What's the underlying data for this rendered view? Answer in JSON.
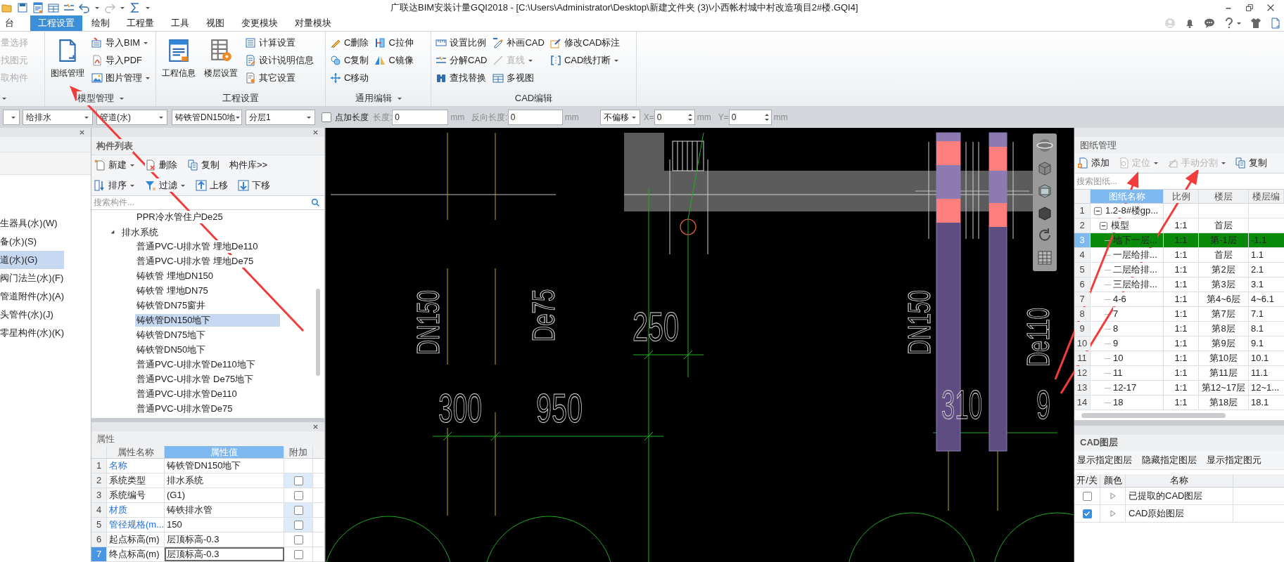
{
  "title_bar": {
    "title": "广联达BIM安装计量GQI2018 - [C:\\Users\\Administrator\\Desktop\\新建文件夹 (3)\\小西帐村城中村改造项目2#楼.GQI4]"
  },
  "menu_tabs": [
    {
      "label": "台",
      "selected": false
    },
    {
      "label": "工程设置",
      "selected": true
    },
    {
      "label": "绘制",
      "selected": false
    },
    {
      "label": "工程量",
      "selected": false
    },
    {
      "label": "工具",
      "selected": false
    },
    {
      "label": "视图",
      "selected": false
    },
    {
      "label": "变更模块",
      "selected": false
    },
    {
      "label": "对量模块",
      "selected": false
    }
  ],
  "ribbon_groups": [
    {
      "menu": true,
      "items": [
        {
          "label": "量选择",
          "kind": "small",
          "disabled": true,
          "dropdown": false
        },
        {
          "label": "找图元",
          "kind": "small",
          "disabled": true,
          "dropdown": false
        },
        {
          "label": "取构件",
          "kind": "small",
          "disabled": true,
          "dropdown": false
        }
      ]
    },
    {
      "label": "模型管理",
      "menu": true,
      "items": [
        {
          "label": "图纸管理",
          "kind": "large",
          "disabled": false,
          "dropdown": false
        },
        {
          "label": "导入BIM",
          "kind": "small",
          "disabled": false,
          "dropdown": true
        },
        {
          "label": "导入PDF",
          "kind": "small",
          "disabled": false,
          "dropdown": false
        },
        {
          "label": "图片管理",
          "kind": "small",
          "disabled": false,
          "dropdown": true
        }
      ]
    },
    {
      "label": "工程设置",
      "menu": false,
      "items": [
        {
          "label": "工程信息",
          "kind": "large",
          "disabled": false,
          "dropdown": false
        },
        {
          "label": "楼层设置",
          "kind": "large",
          "disabled": false,
          "dropdown": false
        },
        {
          "label": "计算设置",
          "kind": "small",
          "disabled": false,
          "dropdown": false
        },
        {
          "label": "设计说明信息",
          "kind": "small",
          "disabled": false,
          "dropdown": false
        },
        {
          "label": "其它设置",
          "kind": "small",
          "disabled": false,
          "dropdown": false
        }
      ]
    },
    {
      "label": "通用编辑",
      "menu": true,
      "items": [
        {
          "label": "C删除",
          "kind": "small",
          "disabled": false,
          "dropdown": false
        },
        {
          "label": "C复制",
          "kind": "small",
          "disabled": false,
          "dropdown": false
        },
        {
          "label": "C移动",
          "kind": "small",
          "disabled": false,
          "dropdown": false
        },
        {
          "label": "C拉伸",
          "kind": "small",
          "disabled": false,
          "dropdown": false
        },
        {
          "label": "C镜像",
          "kind": "small",
          "disabled": false,
          "dropdown": false
        }
      ]
    },
    {
      "label": "CAD编辑",
      "menu": false,
      "items": [
        {
          "label": "设置比例",
          "kind": "small",
          "disabled": false,
          "dropdown": false
        },
        {
          "label": "分解CAD",
          "kind": "small",
          "disabled": false,
          "dropdown": false
        },
        {
          "label": "查找替换",
          "kind": "small",
          "disabled": false,
          "dropdown": false
        },
        {
          "label": "补画CAD",
          "kind": "small",
          "disabled": false,
          "dropdown": false
        },
        {
          "label": "直线",
          "kind": "small",
          "disabled": true,
          "dropdown": true
        },
        {
          "label": "多视图",
          "kind": "small",
          "disabled": false,
          "dropdown": false
        },
        {
          "label": "修改CAD标注",
          "kind": "small",
          "disabled": false,
          "dropdown": false
        },
        {
          "label": "CAD线打断",
          "kind": "small",
          "disabled": false,
          "dropdown": true
        }
      ]
    }
  ],
  "toolbar": [
    {
      "kind": "dropdown"
    },
    {
      "kind": "dropdown",
      "value": "给排水"
    },
    {
      "kind": "dropdown",
      "value": "管道(水)"
    },
    {
      "kind": "dropdown",
      "value": "铸铁管DN150地"
    },
    {
      "kind": "dropdown",
      "value": "分层1"
    },
    {
      "kind": "checkbox",
      "label": "点加长度",
      "checked": false
    },
    {
      "kind": "field",
      "label": "长度:",
      "value": "0",
      "unit": "mm",
      "disabled": true
    },
    {
      "kind": "field",
      "label": "反向长度:",
      "value": "0",
      "unit": "mm",
      "disabled": true
    },
    {
      "kind": "dropdown",
      "value": "不偏移"
    },
    {
      "kind": "spin",
      "label": "X=",
      "value": "0",
      "unit": "mm",
      "disabled": true
    },
    {
      "kind": "spin",
      "label": "Y=",
      "value": "0",
      "unit": "mm",
      "disabled": true
    }
  ],
  "category_panel": {
    "items": [
      {
        "label": "生器具(水)(W)",
        "selected": false
      },
      {
        "label": "备(水)(S)",
        "selected": false
      },
      {
        "label": "道(水)(G)",
        "selected": true
      },
      {
        "label": "阀门法兰(水)(F)",
        "selected": false
      },
      {
        "label": "管道附件(水)(A)",
        "selected": false
      },
      {
        "label": "头管件(水)(J)",
        "selected": false
      },
      {
        "label": "零星构件(水)(K)",
        "selected": false
      }
    ]
  },
  "component_panel": {
    "title": "构件列表",
    "toolbar": [
      {
        "label": "新建",
        "dropdown": true
      },
      {
        "label": "删除",
        "dropdown": false
      },
      {
        "label": "复制",
        "dropdown": false
      },
      {
        "label": "构件库>>",
        "dropdown": false
      },
      {
        "label": "排序",
        "dropdown": true
      },
      {
        "label": "过滤",
        "dropdown": true
      },
      {
        "label": "上移",
        "dropdown": false
      },
      {
        "label": "下移",
        "dropdown": false
      }
    ],
    "search_placeholder": "搜索构件...",
    "tree": [
      {
        "label": "PPR冷水管住户De25",
        "selected": false
      },
      {
        "label": "排水系统",
        "selected": false,
        "expanded": true,
        "children": [
          {
            "label": "普通PVC-U排水管 埋地De110",
            "selected": false
          },
          {
            "label": "普通PVC-U排水管 埋地De75",
            "selected": false
          },
          {
            "label": "铸铁管 埋地DN150",
            "selected": false
          },
          {
            "label": "铸铁管 埋地DN75",
            "selected": false
          },
          {
            "label": "铸铁管DN75窗井",
            "selected": false
          },
          {
            "label": "铸铁管DN150地下",
            "selected": true
          },
          {
            "label": "铸铁管DN75地下",
            "selected": false
          },
          {
            "label": "铸铁管DN50地下",
            "selected": false
          },
          {
            "label": "普通PVC-U排水管De110地下",
            "selected": false
          },
          {
            "label": "普通PVC-U排水管 De75地下",
            "selected": false
          },
          {
            "label": "普通PVC-U排水管De110",
            "selected": false
          },
          {
            "label": "普通PVC-U排水管De75",
            "selected": false
          }
        ]
      }
    ]
  },
  "properties_panel": {
    "title": "属性",
    "columns": [
      "属性名称",
      "属性值",
      "附加"
    ],
    "rows": [
      {
        "num": "1",
        "name": "名称",
        "value": "铸铁管DN150地下",
        "public": true,
        "selected": false
      },
      {
        "num": "2",
        "name": "系统类型",
        "value": "排水系统",
        "public": false,
        "selected": false,
        "checked": false,
        "highlighted": true
      },
      {
        "num": "3",
        "name": "系统编号",
        "value": "(G1)",
        "public": false,
        "selected": false,
        "checked": false,
        "highlighted": false
      },
      {
        "num": "4",
        "name": "材质",
        "value": "铸铁排水管",
        "public": true,
        "selected": false,
        "checked": false,
        "highlighted": true
      },
      {
        "num": "5",
        "name": "管径规格(m...",
        "value": "150",
        "public": true,
        "selected": false,
        "checked": false,
        "highlighted": true
      },
      {
        "num": "6",
        "name": "起点标高(m)",
        "value": "层顶标高-0.3",
        "public": false,
        "selected": false,
        "checked": false,
        "highlighted": false
      },
      {
        "num": "7",
        "name": "终点标高(m)",
        "value": "层顶标高-0.3",
        "public": false,
        "selected": true,
        "checked": false,
        "highlighted": false
      }
    ]
  },
  "canvas": {
    "labels": [
      {
        "text": "DN150",
        "kind": "vertical"
      },
      {
        "text": "De75",
        "kind": "vertical"
      },
      {
        "text": "250",
        "kind": "horizontal"
      },
      {
        "text": "300",
        "kind": "horizontal"
      },
      {
        "text": "950",
        "kind": "horizontal"
      },
      {
        "text": "DN150",
        "kind": "vertical"
      },
      {
        "text": "De110",
        "kind": "vertical"
      },
      {
        "text": "310",
        "kind": "horizontal"
      },
      {
        "text": "9",
        "kind": "horizontal"
      }
    ]
  },
  "drawing_panel": {
    "title": "图纸管理",
    "toolbar": [
      {
        "label": "添加",
        "disabled": false,
        "dropdown": false
      },
      {
        "label": "定位",
        "disabled": true,
        "dropdown": true
      },
      {
        "label": "手动分割",
        "disabled": true,
        "dropdown": true
      },
      {
        "label": "复制",
        "disabled": false,
        "dropdown": false
      }
    ],
    "search_placeholder": "搜索图纸...",
    "columns": [
      "图纸名称",
      "比例",
      "楼层",
      "楼层编"
    ],
    "rows": [
      {
        "num": "1",
        "name": "1.2-8#楼gp...",
        "selected": false,
        "expanded": true,
        "children": [
          {
            "num": "2",
            "name": "模型",
            "scale": "1:1",
            "floor": "首层",
            "selected": false,
            "expanded": true,
            "children": [
              {
                "num": "3",
                "name": "地下一层...",
                "scale": "1:1",
                "floor": "第-1层",
                "code": "-1.1",
                "selected": true
              },
              {
                "num": "4",
                "name": "一层给排...",
                "scale": "1:1",
                "floor": "首层",
                "code": "1.1",
                "selected": false
              },
              {
                "num": "5",
                "name": "二层给排...",
                "scale": "1:1",
                "floor": "第2层",
                "code": "2.1",
                "selected": false
              },
              {
                "num": "6",
                "name": "三层给排...",
                "scale": "1:1",
                "floor": "第3层",
                "code": "3.1",
                "selected": false
              },
              {
                "num": "7",
                "name": "4-6",
                "scale": "1:1",
                "floor": "第4~6层",
                "code": "4~6.1",
                "selected": false
              },
              {
                "num": "8",
                "name": "7",
                "scale": "1:1",
                "floor": "第7层",
                "code": "7.1",
                "selected": false
              },
              {
                "num": "9",
                "name": "8",
                "scale": "1:1",
                "floor": "第8层",
                "code": "8.1",
                "selected": false
              },
              {
                "num": "10",
                "name": "9",
                "scale": "1:1",
                "floor": "第9层",
                "code": "9.1",
                "selected": false
              },
              {
                "num": "11",
                "name": "10",
                "scale": "1:1",
                "floor": "第10层",
                "code": "10.1",
                "selected": false
              },
              {
                "num": "12",
                "name": "11",
                "scale": "1:1",
                "floor": "第11层",
                "code": "11.1",
                "selected": false
              },
              {
                "num": "13",
                "name": "12-17",
                "scale": "1:1",
                "floor": "第12~17层",
                "code": "12~1...",
                "selected": false
              },
              {
                "num": "14",
                "name": "18",
                "scale": "1:1",
                "floor": "第18层",
                "code": "18.1",
                "selected": false
              }
            ]
          }
        ]
      }
    ]
  },
  "cad_layers": {
    "title": "CAD图层",
    "actions": [
      "显示指定图层",
      "隐藏指定图层",
      "显示指定图元"
    ],
    "columns": [
      "开/关",
      "颜色",
      "名称"
    ],
    "rows": [
      {
        "name": "已提取的CAD图层",
        "checked": false
      },
      {
        "name": "CAD原始图层",
        "checked": true
      }
    ]
  }
}
